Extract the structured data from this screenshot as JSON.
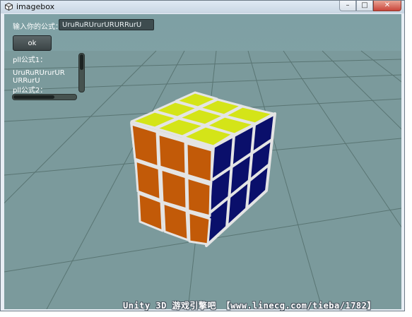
{
  "window": {
    "title": "imagebox",
    "icon": "unity-icon",
    "controls": [
      "minimize-icon",
      "maximize-icon",
      "close-icon"
    ]
  },
  "ui": {
    "formula_label": "输入你的公式：",
    "formula_value": "UruRuRUrurURURRurU",
    "ok_label": "ok",
    "pll1_label": "pll公式1：",
    "pll1_text_line1": "UruRuRUrurUR",
    "pll1_text_line2": "URRurU",
    "pll2_label": "pll公式2："
  },
  "watermark": "Unity 3D 游戏引擎吧 【www.linecg.com/tieba/1782】",
  "colors": {
    "sky": "#7f9ea1",
    "floor": "#7b9a9c",
    "cube_top": "#d4e418",
    "cube_left": "#c25a08",
    "cube_right": "#0a0f6b",
    "cube_gap": "#e8e8e8"
  }
}
